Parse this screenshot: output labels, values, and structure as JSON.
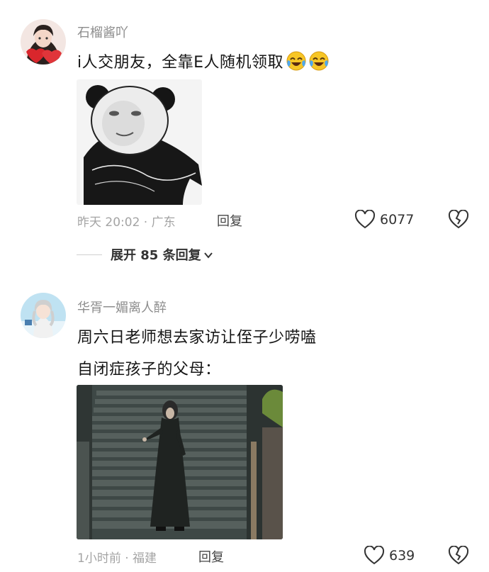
{
  "comments": [
    {
      "username": "石榴酱吖",
      "text": "i人交朋友，全靠E人随机领取",
      "emoji_icons": [
        "laughing-crying-emoji-icon",
        "laughing-crying-emoji-icon"
      ],
      "image_description_icon": "panda-meme-image",
      "meta": "昨天 20:02 · 广东",
      "reply_label": "回复",
      "likes": "6077",
      "expand_replies": "展开 85 条回复"
    },
    {
      "username": "华胥一媚离人醉",
      "text_line1": "周六日老师想去家访让侄子少唠嗑",
      "text_line2": "自闭症孩子的父母：",
      "image_description_icon": "stairs-figure-image",
      "meta": "1小时前 · 福建",
      "reply_label": "回复",
      "likes": "639"
    }
  ],
  "colors": {
    "username": "#8d8d8d",
    "text": "#161616",
    "meta": "#a4a4a4"
  }
}
